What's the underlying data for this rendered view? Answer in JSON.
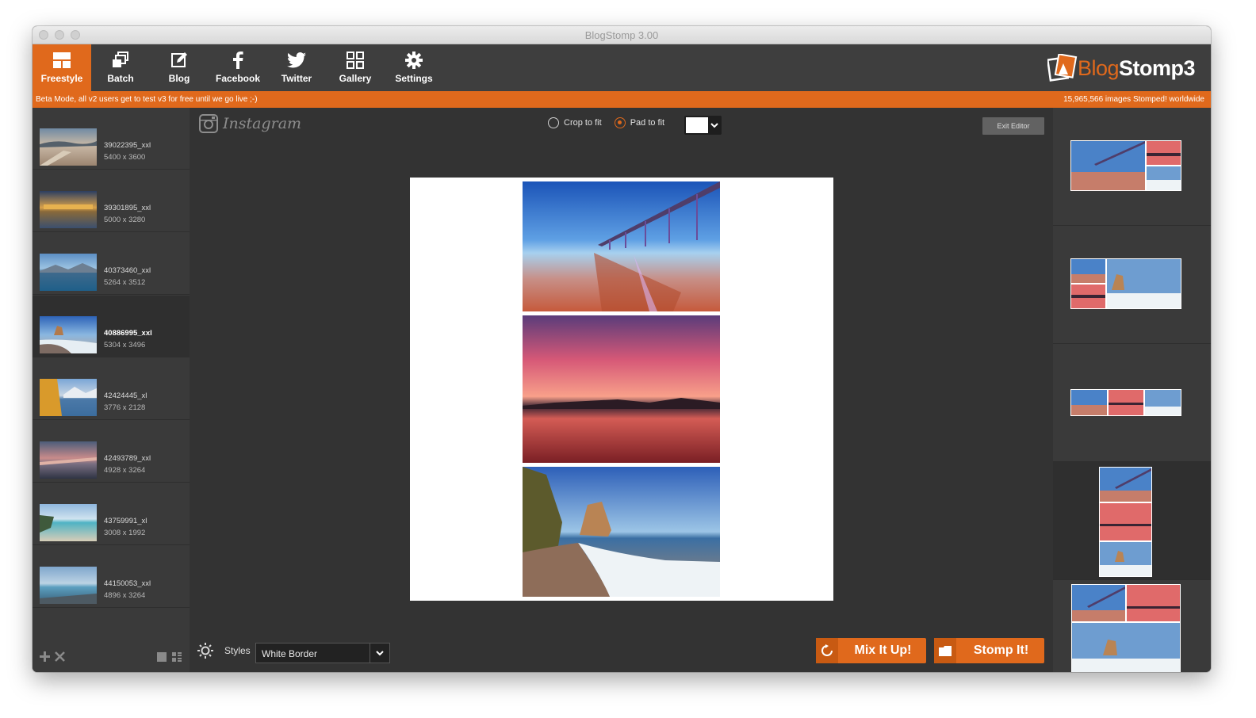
{
  "window": {
    "title": "BlogStomp 3.00"
  },
  "toolbar": {
    "items": [
      {
        "label": "Freestyle",
        "icon": "freestyle-icon",
        "active": true
      },
      {
        "label": "Batch",
        "icon": "batch-icon"
      },
      {
        "label": "Blog",
        "icon": "blog-edit-icon"
      },
      {
        "label": "Facebook",
        "icon": "facebook-icon"
      },
      {
        "label": "Twitter",
        "icon": "twitter-icon"
      },
      {
        "label": "Gallery",
        "icon": "gallery-grid-icon"
      },
      {
        "label": "Settings",
        "icon": "gear-icon"
      }
    ],
    "brand": {
      "name_part1": "Blog",
      "name_part2": "Stomp3"
    }
  },
  "beta_bar": {
    "left": "Beta Mode, all v2 users get to test v3 for free until we go live ;-)",
    "right": "15,965,566 images Stomped! worldwide"
  },
  "files": [
    {
      "name": "39022395_xxl",
      "dims": "5400 x 3600"
    },
    {
      "name": "39301895_xxl",
      "dims": "5000 x 3280"
    },
    {
      "name": "40373460_xxl",
      "dims": "5264 x 3512"
    },
    {
      "name": "40886995_xxl",
      "dims": "5304 x 3496",
      "selected": true
    },
    {
      "name": "42424445_xl",
      "dims": "3776 x 2128"
    },
    {
      "name": "42493789_xxl",
      "dims": "4928 x 3264"
    },
    {
      "name": "43759991_xl",
      "dims": "3008 x 1992"
    },
    {
      "name": "44150053_xxl",
      "dims": "4896 x 3264"
    }
  ],
  "editor": {
    "platform": "Instagram",
    "crop_option": "Crop to fit",
    "pad_option": "Pad to fit",
    "selected_fit": "pad",
    "pad_color": "#ffffff",
    "exit_label": "Exit Editor"
  },
  "bottom": {
    "styles_label": "Styles",
    "style_value": "White Border",
    "mix_label": "Mix It Up!",
    "stomp_label": "Stomp It!"
  },
  "colors": {
    "accent": "#e0691c",
    "background": "#333333",
    "panel": "#3a3a3a"
  }
}
